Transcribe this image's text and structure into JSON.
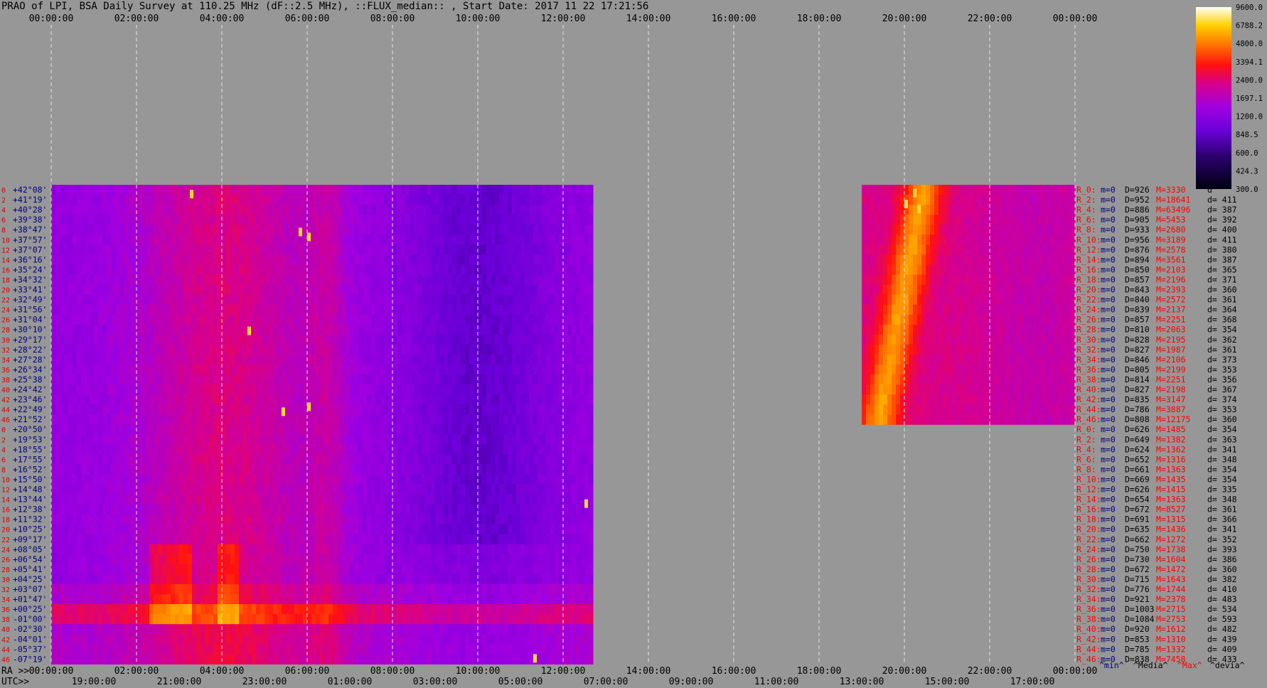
{
  "title": "PRAO of LPI, BSA Daily Survey at 110.25 MHz (dF::2.5 MHz), ::FLUX_median:: , Start Date: 2017 11 22 17:21:56",
  "chart_data": {
    "type": "heatmap",
    "top_axis_ticks": [
      "00:00:00",
      "02:00:00",
      "04:00:00",
      "06:00:00",
      "08:00:00",
      "10:00:00",
      "12:00:00",
      "14:00:00",
      "16:00:00",
      "18:00:00",
      "20:00:00",
      "22:00:00",
      "00:00:00"
    ],
    "ra_axis_prefix": "RA >>",
    "ra_axis_ticks": [
      "00:00:00",
      "02:00:00",
      "04:00:00",
      "06:00:00",
      "08:00:00",
      "10:00:00",
      "12:00:00",
      "14:00:00",
      "16:00:00",
      "18:00:00",
      "20:00:00",
      "22:00:00",
      "00:00:00"
    ],
    "utc_axis_prefix": "UTC>>",
    "utc_axis_ticks": [
      "19:00:00",
      "21:00:00",
      "23:00:00",
      "01:00:00",
      "03:00:00",
      "05:00:00",
      "07:00:00",
      "09:00:00",
      "11:00:00",
      "13:00:00",
      "15:00:00",
      "17:00:00"
    ],
    "colorbar_ticks": [
      "9600.0",
      "6788.2",
      "4800.0",
      "3394.1",
      "2400.0",
      "1697.1",
      "1200.0",
      "848.5",
      "600.0",
      "424.3",
      "300.0"
    ],
    "beam_indices": [
      "0",
      "2",
      "4",
      "6",
      "8",
      "10",
      "12",
      "14",
      "16",
      "18",
      "20",
      "22",
      "24",
      "26",
      "28",
      "30",
      "32",
      "34",
      "36",
      "38",
      "40",
      "42",
      "44",
      "46",
      "0",
      "2",
      "4",
      "6",
      "8",
      "10",
      "12",
      "14",
      "16",
      "18",
      "20",
      "22",
      "24",
      "26",
      "28",
      "30",
      "32",
      "34",
      "36",
      "38",
      "40",
      "42",
      "44",
      "46"
    ],
    "declinations": [
      "+42°08'",
      "+41°19'",
      "+40°28'",
      "+39°38'",
      "+38°47'",
      "+37°57'",
      "+37°07'",
      "+36°16'",
      "+35°24'",
      "+34°32'",
      "+33°41'",
      "+32°49'",
      "+31°56'",
      "+31°04'",
      "+30°10'",
      "+29°17'",
      "+28°22'",
      "+27°28'",
      "+26°34'",
      "+25°38'",
      "+24°42'",
      "+23°46'",
      "+22°49'",
      "+21°52'",
      "+20°50'",
      "+19°53'",
      "+18°55'",
      "+17°55'",
      "+16°52'",
      "+15°50'",
      "+14°48'",
      "+13°44'",
      "+12°38'",
      "+11°32'",
      "+10°25'",
      "+09°17'",
      "+08°05'",
      "+06°54'",
      "+05°41'",
      "+04°25'",
      "+03°07'",
      "+01°47'",
      "+00°25'",
      "-01°00'",
      "-02°30'",
      "-04°01'",
      "-05°37'",
      "-07°19'"
    ],
    "stats": [
      {
        "r": "R_0:",
        "m": "m=0",
        "d": "D=926",
        "h": "M=3330",
        "dev": "d"
      },
      {
        "r": "R_2:",
        "m": "m=0",
        "d": "D=952",
        "h": "M=18641",
        "dev": "d= 411"
      },
      {
        "r": "R_4:",
        "m": "m=0",
        "d": "D=886",
        "h": "M=63496",
        "dev": "d= 387"
      },
      {
        "r": "R_6:",
        "m": "m=0",
        "d": "D=905",
        "h": "M=5453",
        "dev": "d= 392"
      },
      {
        "r": "R_8:",
        "m": "m=0",
        "d": "D=933",
        "h": "M=2680",
        "dev": "d= 400"
      },
      {
        "r": "R_10:",
        "m": "m=0",
        "d": "D=956",
        "h": "M=3189",
        "dev": "d= 411"
      },
      {
        "r": "R_12:",
        "m": "m=0",
        "d": "D=876",
        "h": "M=2578",
        "dev": "d= 380"
      },
      {
        "r": "R_14:",
        "m": "m=0",
        "d": "D=894",
        "h": "M=3561",
        "dev": "d= 387"
      },
      {
        "r": "R_16:",
        "m": "m=0",
        "d": "D=850",
        "h": "M=2103",
        "dev": "d= 365"
      },
      {
        "r": "R_18:",
        "m": "m=0",
        "d": "D=857",
        "h": "M=2196",
        "dev": "d= 371"
      },
      {
        "r": "R_20:",
        "m": "m=0",
        "d": "D=843",
        "h": "M=2393",
        "dev": "d= 360"
      },
      {
        "r": "R_22:",
        "m": "m=0",
        "d": "D=840",
        "h": "M=2572",
        "dev": "d= 361"
      },
      {
        "r": "R_24:",
        "m": "m=0",
        "d": "D=839",
        "h": "M=2137",
        "dev": "d= 364"
      },
      {
        "r": "R_26:",
        "m": "m=0",
        "d": "D=857",
        "h": "M=2251",
        "dev": "d= 368"
      },
      {
        "r": "R_28:",
        "m": "m=0",
        "d": "D=810",
        "h": "M=2063",
        "dev": "d= 354"
      },
      {
        "r": "R_30:",
        "m": "m=0",
        "d": "D=828",
        "h": "M=2195",
        "dev": "d= 362"
      },
      {
        "r": "R_32:",
        "m": "m=0",
        "d": "D=827",
        "h": "M=1987",
        "dev": "d= 361"
      },
      {
        "r": "R_34:",
        "m": "m=0",
        "d": "D=846",
        "h": "M=2106",
        "dev": "d= 373"
      },
      {
        "r": "R_36:",
        "m": "m=0",
        "d": "D=805",
        "h": "M=2199",
        "dev": "d= 353"
      },
      {
        "r": "R_38:",
        "m": "m=0",
        "d": "D=814",
        "h": "M=2251",
        "dev": "d= 356"
      },
      {
        "r": "R_40:",
        "m": "m=0",
        "d": "D=827",
        "h": "M=2198",
        "dev": "d= 367"
      },
      {
        "r": "R_42:",
        "m": "m=0",
        "d": "D=835",
        "h": "M=3147",
        "dev": "d= 374"
      },
      {
        "r": "R_44:",
        "m": "m=0",
        "d": "D=786",
        "h": "M=3887",
        "dev": "d= 353"
      },
      {
        "r": "R_46:",
        "m": "m=0",
        "d": "D=808",
        "h": "M=12175",
        "dev": "d= 360"
      },
      {
        "r": "R_0:",
        "m": "m=0",
        "d": "D=626",
        "h": "M=1485",
        "dev": "d= 354"
      },
      {
        "r": "R_2:",
        "m": "m=0",
        "d": "D=649",
        "h": "M=1382",
        "dev": "d= 363"
      },
      {
        "r": "R_4:",
        "m": "m=0",
        "d": "D=624",
        "h": "M=1362",
        "dev": "d= 341"
      },
      {
        "r": "R_6:",
        "m": "m=0",
        "d": "D=652",
        "h": "M=1316",
        "dev": "d= 348"
      },
      {
        "r": "R_8:",
        "m": "m=0",
        "d": "D=661",
        "h": "M=1363",
        "dev": "d= 354"
      },
      {
        "r": "R_10:",
        "m": "m=0",
        "d": "D=669",
        "h": "M=1435",
        "dev": "d= 354"
      },
      {
        "r": "R_12:",
        "m": "m=0",
        "d": "D=626",
        "h": "M=1415",
        "dev": "d= 335"
      },
      {
        "r": "R_14:",
        "m": "m=0",
        "d": "D=654",
        "h": "M=1363",
        "dev": "d= 348"
      },
      {
        "r": "R_16:",
        "m": "m=0",
        "d": "D=672",
        "h": "M=8527",
        "dev": "d= 361"
      },
      {
        "r": "R_18:",
        "m": "m=0",
        "d": "D=691",
        "h": "M=1315",
        "dev": "d= 366"
      },
      {
        "r": "R_20:",
        "m": "m=0",
        "d": "D=635",
        "h": "M=1436",
        "dev": "d= 341"
      },
      {
        "r": "R_22:",
        "m": "m=0",
        "d": "D=662",
        "h": "M=1272",
        "dev": "d= 352"
      },
      {
        "r": "R_24:",
        "m": "m=0",
        "d": "D=750",
        "h": "M=1738",
        "dev": "d= 393"
      },
      {
        "r": "R_26:",
        "m": "m=0",
        "d": "D=730",
        "h": "M=1604",
        "dev": "d= 386"
      },
      {
        "r": "R_28:",
        "m": "m=0",
        "d": "D=672",
        "h": "M=1472",
        "dev": "d= 360"
      },
      {
        "r": "R_30:",
        "m": "m=0",
        "d": "D=715",
        "h": "M=1643",
        "dev": "d= 382"
      },
      {
        "r": "R_32:",
        "m": "m=0",
        "d": "D=776",
        "h": "M=1744",
        "dev": "d= 410"
      },
      {
        "r": "R_34:",
        "m": "m=0",
        "d": "D=921",
        "h": "M=2378",
        "dev": "d= 483"
      },
      {
        "r": "R_36:",
        "m": "m=0",
        "d": "D=1003",
        "h": "M=2715",
        "dev": "d= 534"
      },
      {
        "r": "R_38:",
        "m": "m=0",
        "d": "D=1084",
        "h": "M=2753",
        "dev": "d= 593"
      },
      {
        "r": "R_40:",
        "m": "m=0",
        "d": "D=920",
        "h": "M=1612",
        "dev": "d= 482"
      },
      {
        "r": "R_42:",
        "m": "m=0",
        "d": "D=853",
        "h": "M=1310",
        "dev": "d= 439"
      },
      {
        "r": "R_44:",
        "m": "m=0",
        "d": "D=785",
        "h": "M=1332",
        "dev": "d= 409"
      },
      {
        "r": "R_46:",
        "m": "m=0",
        "d": "D=838",
        "h": "M=7458",
        "dev": "d= 433"
      }
    ],
    "stats_legend": [
      "^min^",
      "^Media^",
      "^Max^",
      "^devia^"
    ],
    "data_segments": [
      {
        "name": "left",
        "ra_start_h": 0.0,
        "ra_end_h": 12.65,
        "rows": "all"
      },
      {
        "name": "right",
        "ra_start_h": 19.0,
        "ra_end_h": 24.0,
        "rows": "upper"
      }
    ],
    "colors": {
      "background": "#979797",
      "grid": "#e6e6e6",
      "label_red": "#e00000",
      "label_blue": "#000080",
      "stat_red": "#ff0000"
    }
  }
}
